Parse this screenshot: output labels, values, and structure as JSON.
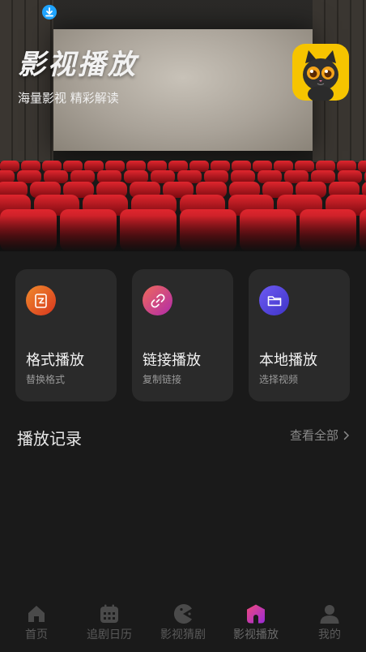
{
  "header": {
    "title": "影视播放",
    "subtitle": "海量影视 精彩解读"
  },
  "actions": [
    {
      "title": "格式播放",
      "subtitle": "替换格式",
      "icon": "format-icon",
      "color": "#e8552a"
    },
    {
      "title": "链接播放",
      "subtitle": "复制链接",
      "icon": "link-icon",
      "color": "#d23a9a"
    },
    {
      "title": "本地播放",
      "subtitle": "选择视频",
      "icon": "folder-icon",
      "color": "#5a4be6"
    }
  ],
  "records": {
    "title": "播放记录",
    "view_all": "查看全部"
  },
  "tabbar": [
    {
      "label": "首页",
      "icon": "home-icon",
      "active": false
    },
    {
      "label": "追剧日历",
      "icon": "calendar-icon",
      "active": false
    },
    {
      "label": "影视猜剧",
      "icon": "pacman-icon",
      "active": false
    },
    {
      "label": "影视播放",
      "icon": "play-house-icon",
      "active": true
    },
    {
      "label": "我的",
      "icon": "user-icon",
      "active": false
    }
  ],
  "colors": {
    "background": "#1a1a1a",
    "card": "#2a2a2a",
    "download_badge": "#1fa4ff",
    "logo_bg": "#f6c400",
    "seat_red": "#c8141e"
  }
}
